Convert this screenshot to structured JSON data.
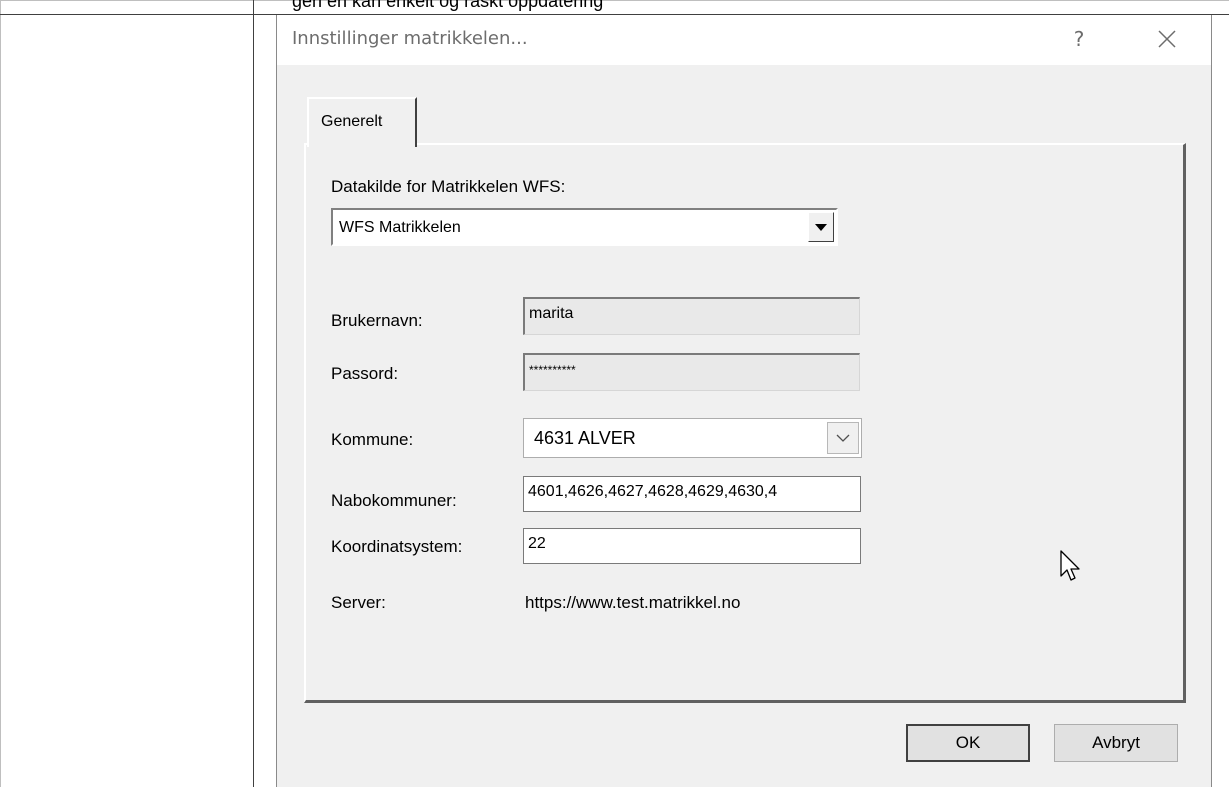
{
  "background": {
    "cut_text": "gen en kan enkelt og raskt oppdatering"
  },
  "dialog": {
    "title": "Innstillinger matrikkelen...",
    "help_label": "?",
    "tabs": [
      {
        "label": "Generelt",
        "selected": true
      }
    ],
    "datasource": {
      "label": "Datakilde for Matrikkelen WFS:",
      "value": "WFS Matrikkelen"
    },
    "username": {
      "label": "Brukernavn:",
      "value": "marita"
    },
    "password": {
      "label": "Passord:",
      "value": "**********"
    },
    "municipality": {
      "label": "Kommune:",
      "value": "4631 ALVER"
    },
    "neighbors": {
      "label": "Nabokommuner:",
      "value": "4601,4626,4627,4628,4629,4630,4"
    },
    "coordsys": {
      "label": "Koordinatsystem:",
      "value": "22"
    },
    "server": {
      "label": "Server:",
      "value": "https://www.test.matrikkel.no"
    },
    "buttons": {
      "ok": "OK",
      "cancel": "Avbryt"
    }
  },
  "icons": {
    "close": "close-icon",
    "dropdown": "chevron-down-icon",
    "cursor": "mouse-pointer-icon"
  }
}
